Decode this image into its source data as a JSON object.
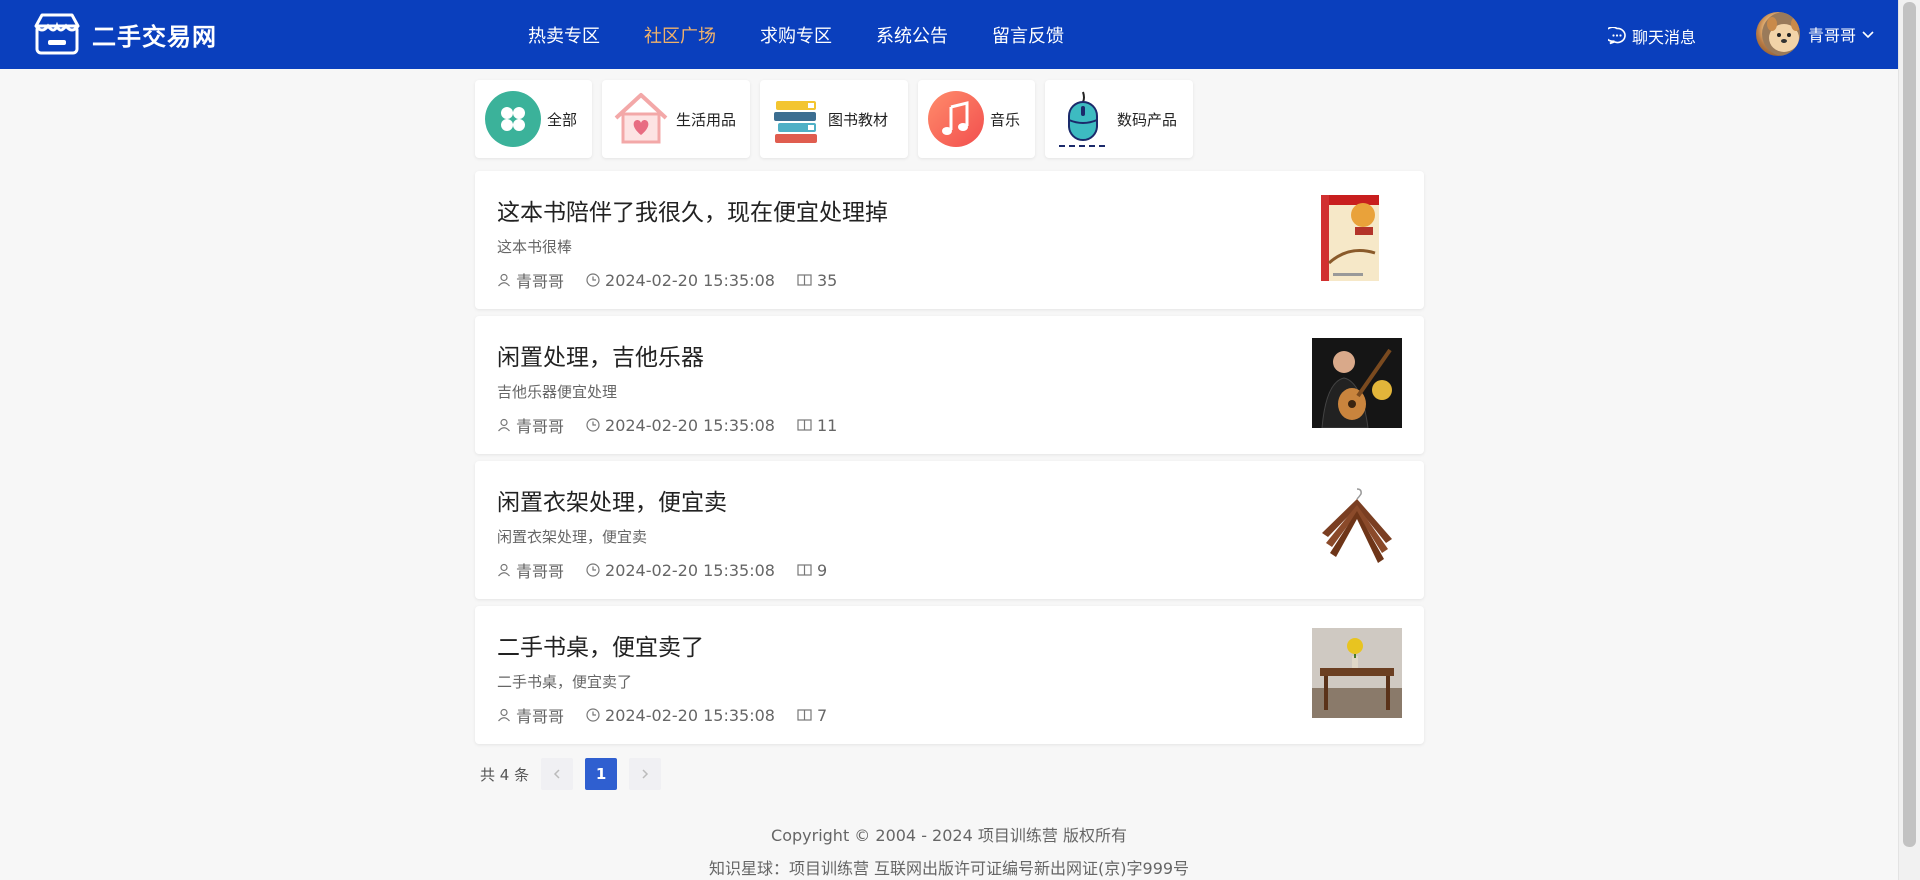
{
  "header": {
    "logo_text": "二手交易网",
    "nav": [
      "热卖专区",
      "社区广场",
      "求购专区",
      "系统公告",
      "留言反馈"
    ],
    "active_nav": 1,
    "chat_label": "聊天消息",
    "user_name": "青哥哥"
  },
  "categories": [
    "全部",
    "生活用品",
    "图书教材",
    "音乐",
    "数码产品"
  ],
  "posts": [
    {
      "title": "这本书陪伴了我很久，现在便宜处理掉",
      "desc": "这本书很棒",
      "author": "青哥哥",
      "time": "2024-02-20 15:35:08",
      "views": "35",
      "image": "book"
    },
    {
      "title": "闲置处理，吉他乐器",
      "desc": "吉他乐器便宜处理",
      "author": "青哥哥",
      "time": "2024-02-20 15:35:08",
      "views": "11",
      "image": "guitar"
    },
    {
      "title": "闲置衣架处理，便宜卖",
      "desc": "闲置衣架处理，便宜卖",
      "author": "青哥哥",
      "time": "2024-02-20 15:35:08",
      "views": "9",
      "image": "hanger"
    },
    {
      "title": "二手书桌，便宜卖了",
      "desc": "二手书桌，便宜卖了",
      "author": "青哥哥",
      "time": "2024-02-20 15:35:08",
      "views": "7",
      "image": "desk"
    }
  ],
  "pagination": {
    "total_text": "共 4 条",
    "current": "1"
  },
  "footer": {
    "copyright": "Copyright © 2004 - 2024 项目训练营 版权所有",
    "license": "知识星球：项目训练营 互联网出版许可证编号新出网证(京)字999号"
  },
  "colors": {
    "header": "#0a3fbd",
    "active_nav": "#f0b26b",
    "page_active": "#2f5fd0"
  }
}
